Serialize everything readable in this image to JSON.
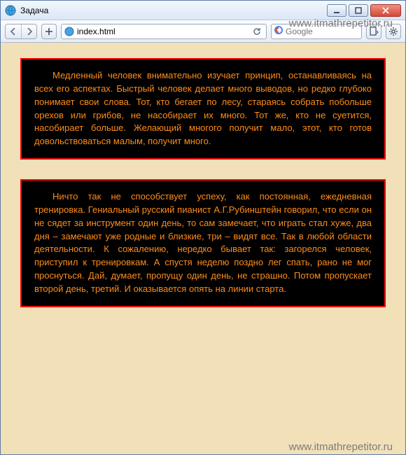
{
  "window": {
    "title": "Задача"
  },
  "toolbar": {
    "url": "index.html",
    "search_placeholder": "Google"
  },
  "watermark": "www.itmathrepetitor.ru",
  "blocks": [
    "Медленный человек внимательно изучает принцип, останавливаясь на всех его аспектах. Быстрый человек делает много выводов, но редко глубоко понимает свои слова. Тот, кто бегает по лесу, стараясь собрать побольше орехов или грибов, не насобирает их много. Тот же, кто не суетится, насобирает больше. Желающий многого получит мало, этот, кто готов довольствоваться малым, получит много.",
    "Ничто так не способствует успеху, как постоянная, ежедневная тренировка. Гениальный русский пианист А.Г.Рубинштейн говорил, что если он не сядет за инструмент один день, то сам замечает, что играть стал хуже, два дня – замечают уже родные и близкие, три – видят все. Так в любой области деятельности. К сожалению, нередко бывает так: загорелся человек, приступил к тренировкам. А спустя неделю поздно лег спать, рано не мог проснуться. Дай, думает, пропущу один день, не страшно. Потом пропускает второй день, третий. И оказывается опять на линии старта."
  ]
}
